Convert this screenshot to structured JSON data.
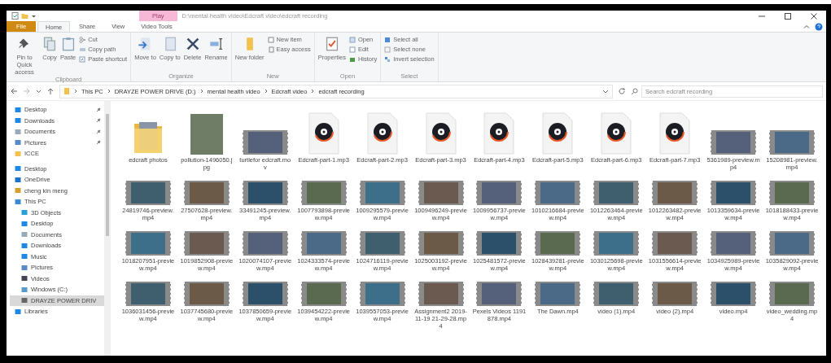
{
  "window": {
    "title": "D:\\mental health video\\Edcraft video\\edcraft recording",
    "contextual_tab": "Play"
  },
  "ribbon_tabs": [
    {
      "label": "File",
      "kind": "file",
      "selected": false
    },
    {
      "label": "Home",
      "kind": "tab",
      "selected": true
    },
    {
      "label": "Share",
      "kind": "tab",
      "selected": false
    },
    {
      "label": "View",
      "kind": "tab",
      "selected": false
    },
    {
      "label": "Video Tools",
      "kind": "tab",
      "selected": false
    }
  ],
  "ribbon_groups": [
    {
      "label": "Clipboard",
      "commands": [
        {
          "label": "Pin to Quick access",
          "kind": "large"
        },
        {
          "label": "Copy",
          "kind": "large"
        },
        {
          "label": "Paste",
          "kind": "large"
        },
        {
          "label": "Cut",
          "kind": "small"
        },
        {
          "label": "Copy path",
          "kind": "small"
        },
        {
          "label": "Paste shortcut",
          "kind": "small"
        }
      ]
    },
    {
      "label": "Organize",
      "commands": [
        {
          "label": "Move to",
          "kind": "large"
        },
        {
          "label": "Copy to",
          "kind": "large"
        },
        {
          "label": "Delete",
          "kind": "large"
        },
        {
          "label": "Rename",
          "kind": "large"
        }
      ]
    },
    {
      "label": "New",
      "commands": [
        {
          "label": "New folder",
          "kind": "large"
        },
        {
          "label": "New item",
          "kind": "small"
        },
        {
          "label": "Easy access",
          "kind": "small"
        }
      ]
    },
    {
      "label": "Open",
      "commands": [
        {
          "label": "Properties",
          "kind": "large"
        },
        {
          "label": "Open",
          "kind": "small"
        },
        {
          "label": "Edit",
          "kind": "small"
        },
        {
          "label": "History",
          "kind": "small"
        }
      ]
    },
    {
      "label": "Select",
      "commands": [
        {
          "label": "Select all",
          "kind": "small"
        },
        {
          "label": "Select none",
          "kind": "small"
        },
        {
          "label": "Invert selection",
          "kind": "small"
        }
      ]
    }
  ],
  "address_bar": {
    "breadcrumbs": [
      "This PC",
      "DRAYZE POWER DRIVE (D:)",
      "mental health video",
      "Edcraft video",
      "edcraft recording"
    ],
    "search_placeholder": "Search edcraft recording"
  },
  "sidebar": {
    "items": [
      {
        "label": "Desktop",
        "pinned": true,
        "selected": false
      },
      {
        "label": "Downloads",
        "pinned": true,
        "selected": false
      },
      {
        "label": "Documents",
        "pinned": true,
        "selected": false
      },
      {
        "label": "Pictures",
        "pinned": true,
        "selected": false
      },
      {
        "label": "ICCE",
        "pinned": false,
        "selected": false
      },
      {
        "label": "Desktop",
        "pinned": false,
        "selected": false
      },
      {
        "label": "OneDrive",
        "pinned": false,
        "selected": false
      },
      {
        "label": "cheng kin meng",
        "pinned": false,
        "selected": false
      },
      {
        "label": "This PC",
        "pinned": false,
        "selected": false,
        "children": [
          {
            "label": "3D Objects",
            "selected": false
          },
          {
            "label": "Desktop",
            "selected": false
          },
          {
            "label": "Documents",
            "selected": false
          },
          {
            "label": "Downloads",
            "selected": false
          },
          {
            "label": "Music",
            "selected": false
          },
          {
            "label": "Pictures",
            "selected": false
          },
          {
            "label": "Videos",
            "selected": false
          },
          {
            "label": "Windows (C:)",
            "selected": false
          },
          {
            "label": "DRAYZE POWER DRIV",
            "selected": true
          }
        ]
      },
      {
        "label": "Libraries",
        "pinned": false,
        "selected": false
      }
    ]
  },
  "files": [
    {
      "name": "edcraft photos",
      "kind": "folder"
    },
    {
      "name": "pollution-1496050.jpg",
      "kind": "image"
    },
    {
      "name": "turtlefor edcraft.mov",
      "kind": "video"
    },
    {
      "name": "Edcraft-part-1.mp3",
      "kind": "audio"
    },
    {
      "name": "Edcraft-part-2.mp3",
      "kind": "audio"
    },
    {
      "name": "Edcraft-part-3.mp3",
      "kind": "audio"
    },
    {
      "name": "Edcraft-part-4.mp3",
      "kind": "audio"
    },
    {
      "name": "Edcraft-part-5.mp3",
      "kind": "audio"
    },
    {
      "name": "Edcraft-part-6.mp3",
      "kind": "audio"
    },
    {
      "name": "Edcraft-part-7.mp3",
      "kind": "audio"
    },
    {
      "name": "5361989-preview.mp4",
      "kind": "video"
    },
    {
      "name": "15208981-preview.mp4",
      "kind": "video"
    },
    {
      "name": "24819746-preview.mp4",
      "kind": "video"
    },
    {
      "name": "27507628-preview.mp4",
      "kind": "video"
    },
    {
      "name": "33491245-preview.mp4",
      "kind": "video"
    },
    {
      "name": "1007793898-preview.mp4",
      "kind": "video"
    },
    {
      "name": "1009295579-preview.mp4",
      "kind": "video"
    },
    {
      "name": "1009496249-preview.mp4",
      "kind": "video"
    },
    {
      "name": "1009956737-preview.mp4",
      "kind": "video"
    },
    {
      "name": "1010216684-preview.mp4",
      "kind": "video"
    },
    {
      "name": "1012263464-preview.mp4",
      "kind": "video"
    },
    {
      "name": "1012263482-preview.mp4",
      "kind": "video"
    },
    {
      "name": "1013359634-preview.mp4",
      "kind": "video"
    },
    {
      "name": "1018188433-preview.mp4",
      "kind": "video"
    },
    {
      "name": "1018207951-preview.mp4",
      "kind": "video"
    },
    {
      "name": "1019852908-preview.mp4",
      "kind": "video"
    },
    {
      "name": "1020074107-preview.mp4",
      "kind": "video"
    },
    {
      "name": "1024333574-preview.mp4",
      "kind": "video"
    },
    {
      "name": "1024716119-preview.mp4",
      "kind": "video"
    },
    {
      "name": "1025003192-preview.mp4",
      "kind": "video"
    },
    {
      "name": "1025481572-preview.mp4",
      "kind": "video"
    },
    {
      "name": "1028439281-preview.mp4",
      "kind": "video"
    },
    {
      "name": "1030125698-preview.mp4",
      "kind": "video"
    },
    {
      "name": "1031556614-preview.mp4",
      "kind": "video"
    },
    {
      "name": "1034925989-preview.mp4",
      "kind": "video"
    },
    {
      "name": "1035829092-preview.mp4",
      "kind": "video"
    },
    {
      "name": "1036031456-preview.mp4",
      "kind": "video"
    },
    {
      "name": "1037745680-preview.mp4",
      "kind": "video"
    },
    {
      "name": "1037850659-preview.mp4",
      "kind": "video"
    },
    {
      "name": "1039454222-preview.mp4",
      "kind": "video"
    },
    {
      "name": "1039557053-preview.mp4",
      "kind": "video"
    },
    {
      "name": "Assignment2 2019-11-19 21-29-28.mp4",
      "kind": "video"
    },
    {
      "name": "Pexels Videos 1191878.mp4",
      "kind": "video"
    },
    {
      "name": "The Dawn.mp4",
      "kind": "video"
    },
    {
      "name": "video (1).mp4",
      "kind": "video"
    },
    {
      "name": "video (2).mp4",
      "kind": "video"
    },
    {
      "name": "video.mp4",
      "kind": "video"
    },
    {
      "name": "video_wedding.mp4",
      "kind": "video"
    }
  ]
}
